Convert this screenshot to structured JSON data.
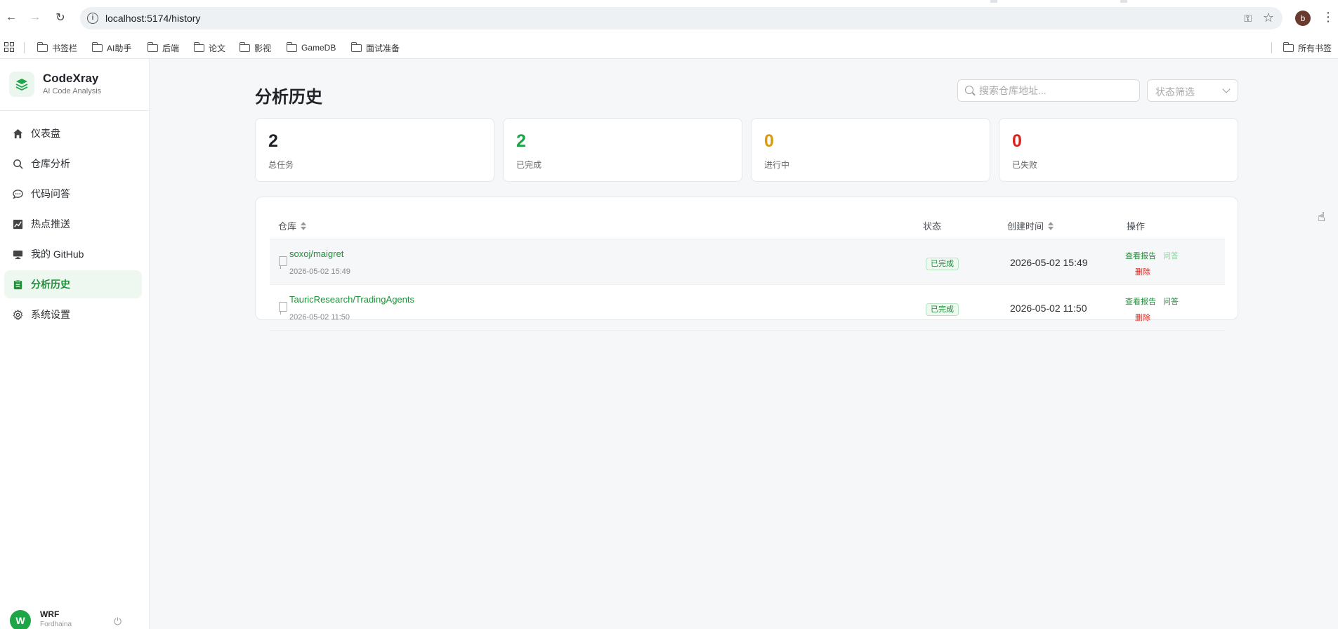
{
  "browser": {
    "url": "localhost:5174/history",
    "profile_initial": "b",
    "bookmarks": [
      "书签栏",
      "AI助手",
      "后端",
      "论文",
      "影视",
      "GameDB",
      "面试准备"
    ],
    "all_bookmarks": "所有书签"
  },
  "app": {
    "brand": {
      "title": "CodeXray",
      "subtitle": "AI Code Analysis"
    },
    "nav": [
      {
        "label": "仪表盘",
        "icon": "home-icon"
      },
      {
        "label": "仓库分析",
        "icon": "search-icon"
      },
      {
        "label": "代码问答",
        "icon": "chat-icon"
      },
      {
        "label": "热点推送",
        "icon": "trend-icon"
      },
      {
        "label": "我的 GitHub",
        "icon": "monitor-icon"
      },
      {
        "label": "分析历史",
        "icon": "clipboard-icon",
        "active": true
      },
      {
        "label": "系统设置",
        "icon": "gear-icon"
      }
    ],
    "user": {
      "initial": "W",
      "name": "WRF",
      "sub": "Fordhaina"
    }
  },
  "page": {
    "title": "分析历史",
    "search_placeholder": "搜索仓库地址...",
    "status_filter": "状态筛选"
  },
  "stats": [
    {
      "value": "2",
      "label": "总任务",
      "color": "#1f2328"
    },
    {
      "value": "2",
      "label": "已完成",
      "color": "#1ea548"
    },
    {
      "value": "0",
      "label": "进行中",
      "color": "#d99a0b"
    },
    {
      "value": "0",
      "label": "已失败",
      "color": "#d9231e"
    }
  ],
  "table": {
    "headers": {
      "repo": "仓库",
      "status": "状态",
      "created": "创建时间",
      "actions": "操作"
    },
    "rows": [
      {
        "repo": "soxoj/maigret",
        "date": "2026-05-02 15:49",
        "status": "已完成",
        "created": "2026-05-02 15:49",
        "view": "查看报告",
        "qa": "问答",
        "delete": "删除"
      },
      {
        "repo": "TauricResearch/TradingAgents",
        "date": "2026-05-02 11:50",
        "status": "已完成",
        "created": "2026-05-02 11:50",
        "view": "查看报告",
        "qa": "问答",
        "delete": "删除"
      }
    ]
  },
  "colors": {
    "accent": "#1ea548",
    "danger": "#d9231e",
    "warning": "#d99a0b"
  }
}
